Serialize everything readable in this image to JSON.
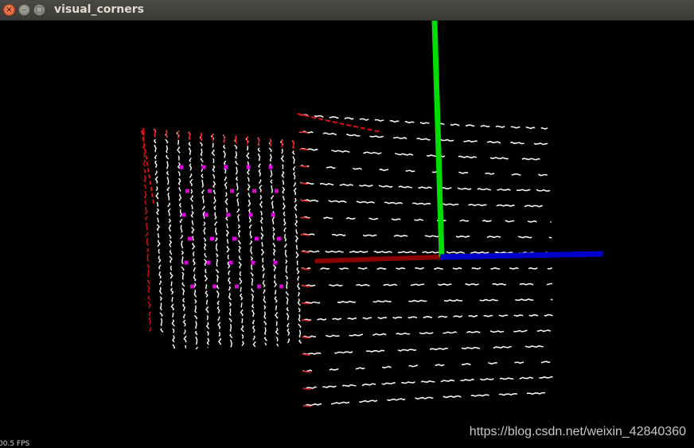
{
  "window": {
    "title": "visual_corners"
  },
  "overlay": {
    "fps_text": "00.5 FPS",
    "watermark": "https://blog.csdn.net/weixin_42840360"
  },
  "scene": {
    "background": "#000000",
    "point_color": "#ffffff",
    "edge_color": "#e01010",
    "corner_marker_color": "#e000e0",
    "axes": {
      "x_color": "#8b0000",
      "y_color": "#00dd00",
      "z_color": "#0000cc"
    }
  }
}
